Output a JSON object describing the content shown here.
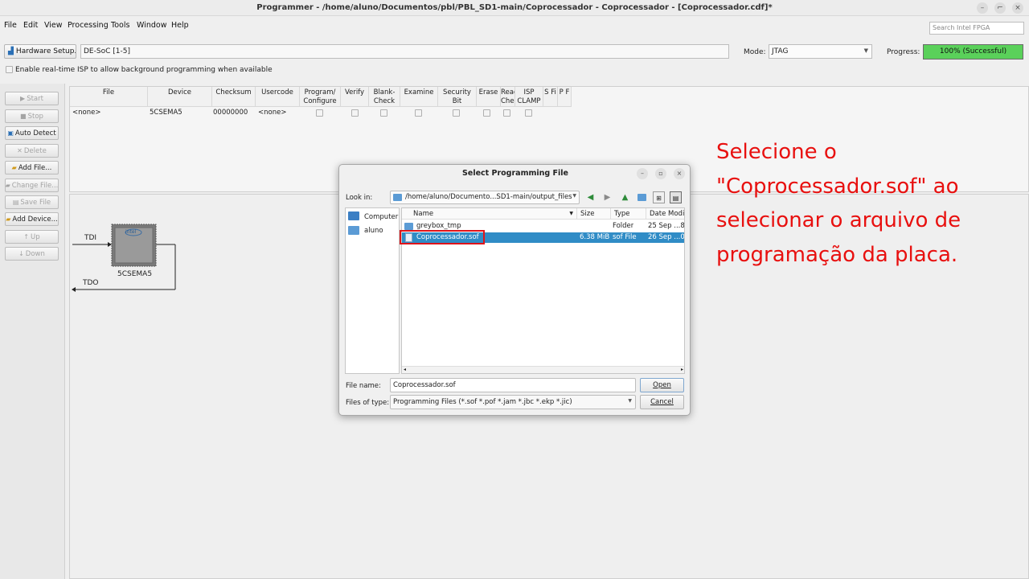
{
  "window": {
    "title": "Programmer - /home/aluno/Documentos/pbl/PBL_SD1-main/Coprocessador - Coprocessador - [Coprocessador.cdf]*",
    "controls": [
      "–",
      "⌐",
      "×"
    ]
  },
  "menu": [
    "File",
    "Edit",
    "View",
    "Processing",
    "Tools",
    "Window",
    "Help"
  ],
  "search": {
    "placeholder": "Search Intel FPGA"
  },
  "hardware": {
    "setup_label": "Hardware Setup...",
    "device_value": "DE-SoC [1-5]",
    "mode_label": "Mode:",
    "mode_value": "JTAG",
    "progress_label": "Progress:",
    "progress_text": "100% (Successful)",
    "progress_value": 1.0,
    "isp_label": "Enable real-time ISP to allow background programming when available"
  },
  "sidebar": {
    "buttons": [
      {
        "label": "Start",
        "icon": "start-icon",
        "enabled": false
      },
      {
        "label": "Stop",
        "icon": "stop-icon",
        "enabled": false
      },
      {
        "label": "Auto Detect",
        "icon": "auto-detect-icon",
        "enabled": true
      },
      {
        "label": "Delete",
        "icon": "delete-icon",
        "enabled": false
      },
      {
        "label": "Add File...",
        "icon": "add-file-icon",
        "enabled": true
      },
      {
        "label": "Change File...",
        "icon": "change-file-icon",
        "enabled": false
      },
      {
        "label": "Save File",
        "icon": "save-file-icon",
        "enabled": false
      },
      {
        "label": "Add Device...",
        "icon": "add-device-icon",
        "enabled": true
      },
      {
        "label": "Up",
        "icon": "up-icon",
        "enabled": false
      },
      {
        "label": "Down",
        "icon": "down-icon",
        "enabled": false
      }
    ]
  },
  "table": {
    "headers": [
      "File",
      "Device",
      "Checksum",
      "Usercode",
      "Program/\nConfigure",
      "Verify",
      "Blank-\nCheck",
      "Examine",
      "Security\nBit",
      "Erase",
      "Read\nChecks",
      "ISP\nCLAMP",
      "S Fi",
      "P F"
    ],
    "row": {
      "file": "<none>",
      "device": "5CSEMA5",
      "checksum": "00000000",
      "usercode": "<none>"
    }
  },
  "chain": {
    "tdi": "TDI",
    "tdo": "TDO",
    "device_label": "5CSEMA5",
    "chip_brand": "intel"
  },
  "dialog": {
    "title": "Select Programming File",
    "look_in_label": "Look in:",
    "look_in_value": "/home/aluno/Documento...SD1-main/output_files",
    "places": [
      {
        "label": "Computer",
        "icon": "computer-icon"
      },
      {
        "label": "aluno",
        "icon": "folder-icon"
      }
    ],
    "columns": [
      "Name",
      "Size",
      "Type",
      "Date Modif"
    ],
    "files": [
      {
        "name": "greybox_tmp",
        "size": "",
        "type": "Folder",
        "date": "25 Sep ...8",
        "icon": "folder-icon",
        "selected": false
      },
      {
        "name": "Coprocessador.sof",
        "size": "6.38 MiB",
        "type": "sof File",
        "date": "26 Sep ...0",
        "icon": "file-icon",
        "selected": true
      }
    ],
    "file_name_label": "File name:",
    "file_name_value": "Coprocessador.sof",
    "files_of_type_label": "Files of type:",
    "files_of_type_value": "Programming Files (*.sof *.pof *.jam *.jbc *.ekp *.jic)",
    "open_label": "Open",
    "cancel_label": "Cancel"
  },
  "annotation": {
    "lines": [
      "Selecione o",
      "\"Coprocessador.sof\"  ao",
      "selecionar o arquivo de",
      "programação da placa."
    ],
    "color": "#e8100f"
  },
  "colors": {
    "progress_fill": "#5ad15a",
    "selection": "#308cc6",
    "highlight_box": "#e0141a"
  }
}
